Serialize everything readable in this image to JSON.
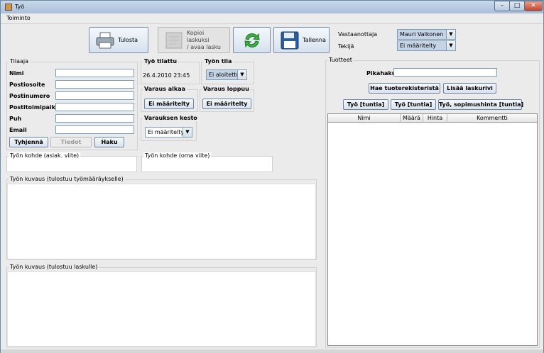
{
  "window": {
    "title": "Työ",
    "minimize": "–",
    "maximize": "□",
    "close": "✕"
  },
  "menu": {
    "items": [
      "Toiminto"
    ]
  },
  "toolbar": {
    "print": "Tulosta",
    "copy_line1": "Kopioi laskuksi",
    "copy_line2": "/ avaa lasku",
    "save": "Tallenna"
  },
  "assignment": {
    "recipient_label": "Vastaanottaja",
    "recipient_value": "Mauri Valkonen",
    "maker_label": "Tekijä",
    "maker_value": "Ei määritelty"
  },
  "customer": {
    "title": "Tilaaja",
    "fields": [
      {
        "label": "Nimi",
        "value": ""
      },
      {
        "label": "Postiosoite",
        "value": ""
      },
      {
        "label": "Postinumero",
        "value": ""
      },
      {
        "label": "Postitoimipaikka",
        "value": ""
      },
      {
        "label": "Puh",
        "value": ""
      },
      {
        "label": "Email",
        "value": ""
      }
    ],
    "clear": "Tyhjennä",
    "info": "Tiedot",
    "search": "Haku"
  },
  "order": {
    "ordered_title": "Työ tilattu",
    "ordered_value": "26.4.2010 23:45",
    "state_title": "Työn tila",
    "state_value": "Ei aloitettu",
    "start_title": "Varaus alkaa",
    "start_value": "Ei määritelty",
    "end_title": "Varaus loppuu",
    "end_value": "Ei määritelty",
    "duration_title": "Varauksen kesto",
    "duration_value": "Ei määritelty"
  },
  "target": {
    "customer_ref": "Työn kohde (asiak. viite)",
    "own_ref": "Työn kohde (oma viite)"
  },
  "description": {
    "work_order": "Työn kuvaus (tulostuu työmääräykselle)",
    "invoice": "Työn kuvaus (tulostuu laskulle)"
  },
  "products": {
    "title": "Tuotteet",
    "quick_search_label": "Pikahaku",
    "quick_search_value": "",
    "fetch_registry": "Hae tuoterekisteristä",
    "add_row": "Lisää laskurivi",
    "work_hours": "Työ [tuntia]",
    "work_hours2": "Työ [tuntia]",
    "work_contract": "Työ, sopimushinta [tuntia]",
    "columns": [
      "Nimi",
      "Määrä",
      "Hinta",
      "Kommentti"
    ]
  },
  "colors": {
    "accent": "#7f9db9",
    "selected_combo": "#c4d3e6",
    "titlebar": "#b7cbe0"
  },
  "icons": [
    "printer-icon",
    "document-icon",
    "refresh-icon",
    "floppy-disk-icon",
    "dropdown-arrow-icon"
  ]
}
